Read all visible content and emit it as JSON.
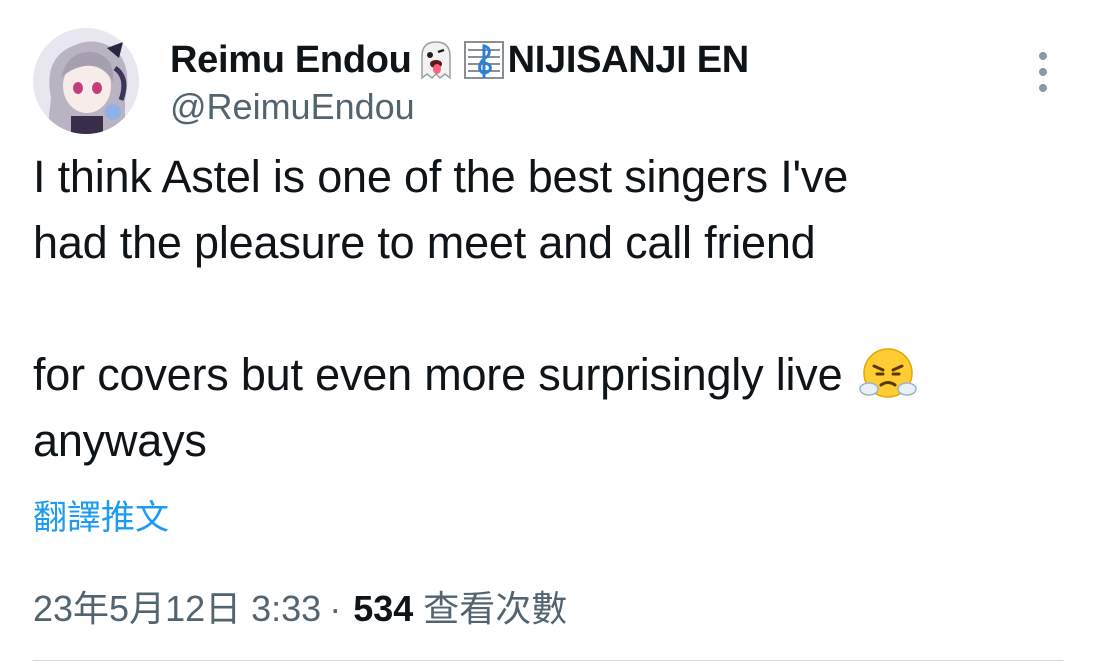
{
  "tweet": {
    "author": {
      "display_name": "Reimu Endou",
      "display_name_suffix": "NIJISANJI EN",
      "name_emojis": [
        "ghost-tongue-emoji",
        "music-score-emoji"
      ],
      "handle": "@ReimuEndou"
    },
    "text_lines": [
      "I think Astel is one of the best singers I've",
      "had the pleasure to meet and call friend",
      "",
      "for covers but even more surprisingly live",
      "anyways"
    ],
    "inline_emoji": "face-with-steam-emoji",
    "translate_label": "翻譯推文",
    "timestamp": "23年5月12日 3:33",
    "separator": "·",
    "views_count": "534",
    "views_label": "查看次數"
  },
  "colors": {
    "text": "#0f1419",
    "secondary": "#536471",
    "link": "#1d9bf0",
    "divider": "#cfd9de"
  }
}
